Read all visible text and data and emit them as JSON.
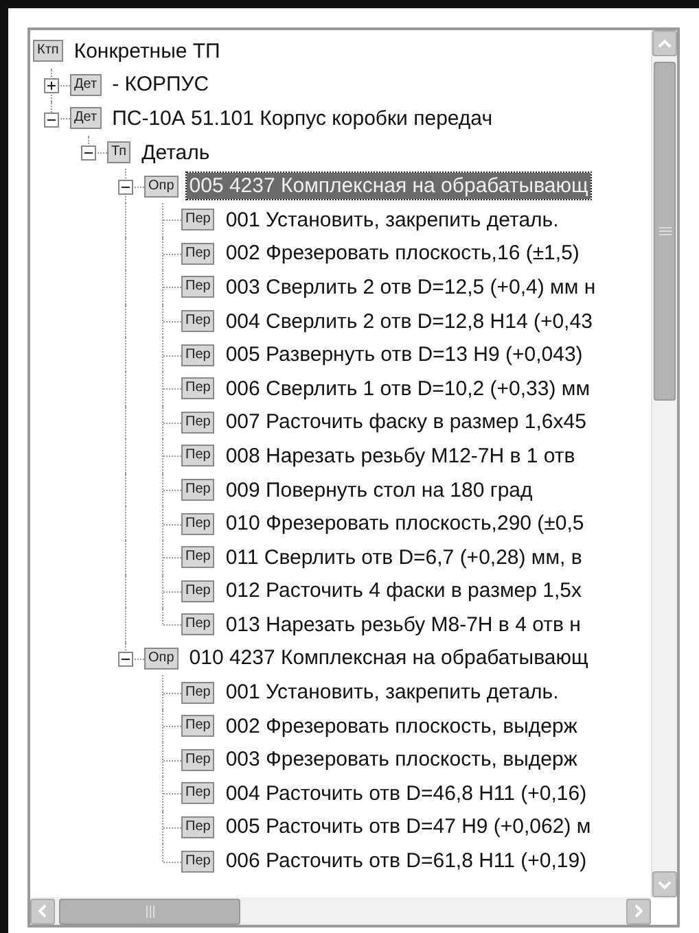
{
  "tree": [
    {
      "tag": "Ктп",
      "label": "Конкретные ТП",
      "selected": false,
      "children": [
        {
          "tag": "Дет",
          "label": "- КОРПУС",
          "selected": false,
          "expanded": false,
          "has_children": true
        },
        {
          "tag": "Дет",
          "label": "ПС-10А 51.101 Корпус коробки передач",
          "selected": false,
          "expanded": true,
          "children": [
            {
              "tag": "Тп",
              "label": "Деталь",
              "selected": false,
              "expanded": true,
              "children": [
                {
                  "tag": "Опр",
                  "label": "005 4237 Комплексная на обрабатывающ",
                  "selected": true,
                  "expanded": true,
                  "children": [
                    {
                      "tag": "Пер",
                      "label": "001 Установить, закрепить  деталь.",
                      "selected": false
                    },
                    {
                      "tag": "Пер",
                      "label": "002 Фрезеровать плоскость,16 (±1,5)",
                      "selected": false
                    },
                    {
                      "tag": "Пер",
                      "label": "003 Сверлить 2 отв D=12,5 (+0,4) мм н",
                      "selected": false
                    },
                    {
                      "tag": "Пер",
                      "label": "004 Сверлить 2 отв D=12,8 H14 (+0,43",
                      "selected": false
                    },
                    {
                      "tag": "Пер",
                      "label": "005 Развернуть отв D=13 H9 (+0,043)",
                      "selected": false
                    },
                    {
                      "tag": "Пер",
                      "label": "006 Сверлить 1 отв D=10,2 (+0,33) мм",
                      "selected": false
                    },
                    {
                      "tag": "Пер",
                      "label": "007 Расточить фаску в размер 1,6x45",
                      "selected": false
                    },
                    {
                      "tag": "Пер",
                      "label": "008 Нарезать резьбу M12-7H в 1 отв",
                      "selected": false
                    },
                    {
                      "tag": "Пер",
                      "label": "009 Повернуть стол на 180 град",
                      "selected": false
                    },
                    {
                      "tag": "Пер",
                      "label": "010 Фрезеровать плоскость,290 (±0,5",
                      "selected": false
                    },
                    {
                      "tag": "Пер",
                      "label": "011 Сверлить отв D=6,7 (+0,28) мм, в",
                      "selected": false
                    },
                    {
                      "tag": "Пер",
                      "label": "012 Расточить 4 фаски в размер 1,5x",
                      "selected": false
                    },
                    {
                      "tag": "Пер",
                      "label": "013 Нарезать резьбу M8-7H в 4 отв н",
                      "selected": false
                    }
                  ]
                },
                {
                  "tag": "Опр",
                  "label": "010 4237 Комплексная на обрабатывающ",
                  "selected": false,
                  "expanded": true,
                  "children": [
                    {
                      "tag": "Пер",
                      "label": "001 Установить, закрепить  деталь.",
                      "selected": false
                    },
                    {
                      "tag": "Пер",
                      "label": "002 Фрезеровать плоскость, выдерж",
                      "selected": false
                    },
                    {
                      "tag": "Пер",
                      "label": "003 Фрезеровать плоскость, выдерж",
                      "selected": false
                    },
                    {
                      "tag": "Пер",
                      "label": "004 Расточить отв D=46,8 H11 (+0,16)",
                      "selected": false
                    },
                    {
                      "tag": "Пер",
                      "label": "005 Расточить отв D=47 H9 (+0,062) м",
                      "selected": false
                    },
                    {
                      "tag": "Пер",
                      "label": "006 Расточить отв D=61,8 H11 (+0,19)",
                      "selected": false
                    }
                  ]
                }
              ]
            }
          ]
        }
      ]
    }
  ]
}
